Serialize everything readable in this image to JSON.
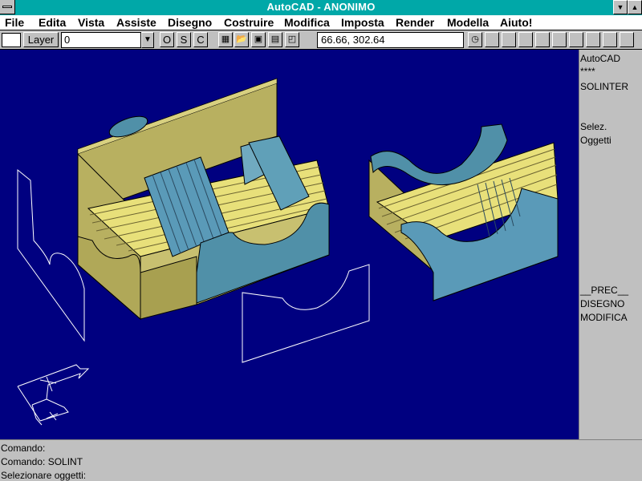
{
  "window": {
    "title": "AutoCAD - ANONIMO"
  },
  "menu": [
    "File",
    "Edita",
    "Vista",
    "Assiste",
    "Disegno",
    "Costruire",
    "Modifica",
    "Imposta",
    "Render",
    "Modella",
    "Aiuto!"
  ],
  "toolbar": {
    "layer_button": "Layer",
    "layer_value": "0",
    "osnap_o": "O",
    "osnap_s": "S",
    "osnap_c": "C",
    "coordinates": "66.66, 302.64"
  },
  "side_menu": {
    "title": "AutoCAD",
    "stars": "****",
    "solinter": "SOLINTER",
    "selez": "Selez.",
    "oggetti": "Oggetti",
    "prec": "__PREC__",
    "disegno": "DISEGNO",
    "modifica": "MODIFICA"
  },
  "command_lines": [
    "Comando:",
    "Comando: SOLINT",
    "Selezionare oggetti:"
  ],
  "icons": [
    "system-menu-icon",
    "minimize-icon",
    "maximize-icon",
    "dropdown-arrow-icon",
    "grid-icon",
    "open-icon",
    "save-icon",
    "print-icon",
    "zoom-icon",
    "clock-icon",
    "ucs-icon"
  ],
  "colors": {
    "canvas": "#000080",
    "title": "#00a8a8",
    "yellow_face": "#b8b060",
    "blue_face": "#5090a8"
  }
}
